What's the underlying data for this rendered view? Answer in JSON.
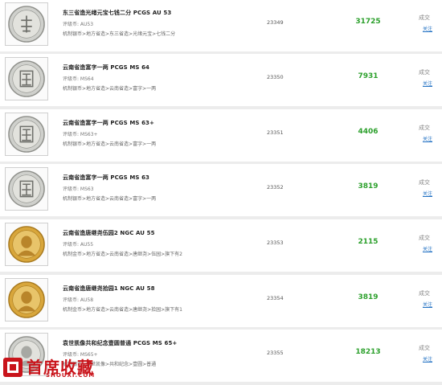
{
  "items": [
    {
      "title": "东三省造光绪元宝七钱二分 PCGS AU 53",
      "grade": "评级币: AU53",
      "category": "机制银币>地方省造>东三省造>光绪元宝>七钱二分",
      "lot": "23349",
      "price": "31725",
      "status": "成交",
      "follow": "关注",
      "coin": "silver-dragon"
    },
    {
      "title": "云南省造富字一两 PCGS MS 64",
      "grade": "评级币: MS64",
      "category": "机制银币>地方省造>云南省造>富字>一两",
      "lot": "23350",
      "price": "7931",
      "status": "成交",
      "follow": "关注",
      "coin": "silver-fu"
    },
    {
      "title": "云南省造富字一两 PCGS MS 63+",
      "grade": "评级币: MS63+",
      "category": "机制银币>地方省造>云南省造>富字>一两",
      "lot": "23351",
      "price": "4406",
      "status": "成交",
      "follow": "关注",
      "coin": "silver-fu"
    },
    {
      "title": "云南省造富字一两 PCGS MS 63",
      "grade": "评级币: MS63",
      "category": "机制银币>地方省造>云南省造>富字>一两",
      "lot": "23352",
      "price": "3819",
      "status": "成交",
      "follow": "关注",
      "coin": "silver-fu"
    },
    {
      "title": "云南省造唐继尧伍园2 NGC AU 55",
      "grade": "评级币: AU55",
      "category": "机制金币>地方省造>云南省造>唐继尧>伍园>旗下有2",
      "lot": "23353",
      "price": "2115",
      "status": "成交",
      "follow": "关注",
      "coin": "gold-portrait"
    },
    {
      "title": "云南省造唐继尧拾园1 NGC AU 58",
      "grade": "评级币: AU58",
      "category": "机制金币>地方省造>云南省造>唐继尧>拾园>旗下有1",
      "lot": "23354",
      "price": "3819",
      "status": "成交",
      "follow": "关注",
      "coin": "gold-portrait"
    },
    {
      "title": "袁世凯像共和纪念壹圆普通 PCGS MS 65+",
      "grade": "评级币: MS65+",
      "category": "机制银币>袁世凯像>共和纪念>壹圆>普通",
      "lot": "23355",
      "price": "18213",
      "status": "成交",
      "follow": "关注",
      "coin": "silver-yuan"
    }
  ],
  "brand": {
    "logo_cn": "首席收藏",
    "logo_en": "SHOUXI.COM"
  },
  "colors": {
    "price": "#2ca02c",
    "link": "#1f6fc2",
    "brand": "#c9141b",
    "separator": "#ececec"
  }
}
